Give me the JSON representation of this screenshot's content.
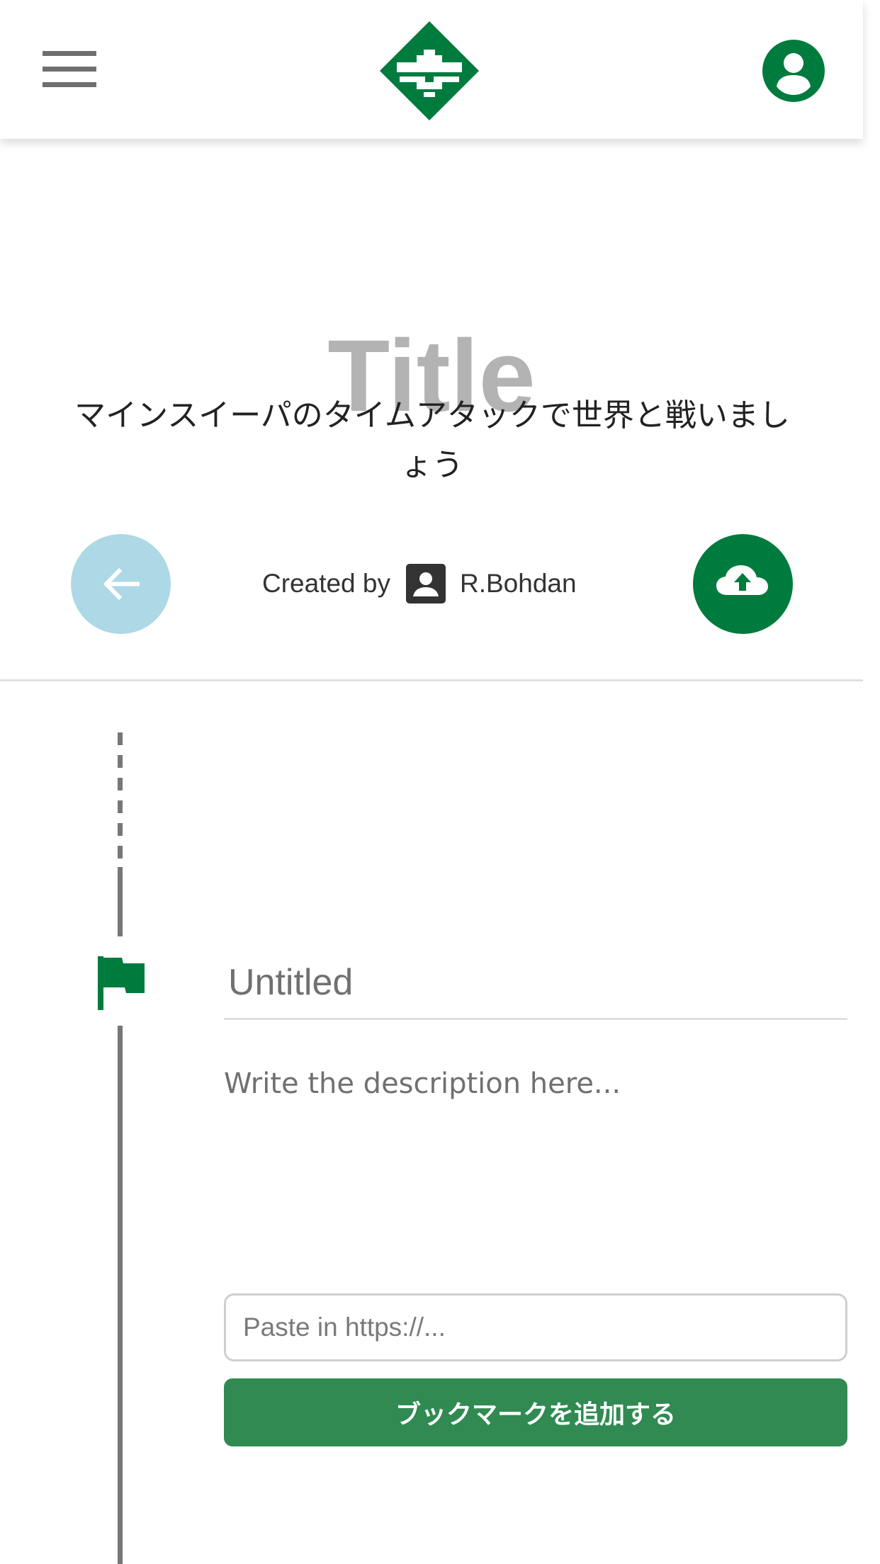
{
  "header": {
    "menu_icon": "hamburger-menu-icon",
    "logo_icon": "green-diamond-logo",
    "account_icon": "account-circle-icon",
    "accent_color": "#007b3e"
  },
  "page": {
    "title": "Title",
    "subtitle": "マインスイーパのタイムアタックで世界と戦いましょう"
  },
  "author": {
    "label": "Created by",
    "name": "R.Bohdan",
    "icon": "person-box-icon"
  },
  "actions": {
    "back_icon": "arrow-left-icon",
    "back_color": "#add8e6",
    "upload_icon": "cloud-upload-icon",
    "upload_color": "#007b3e"
  },
  "timeline": {
    "marker_icon": "flag-icon"
  },
  "entry": {
    "title_value": "",
    "title_placeholder": "Untitled",
    "description_value": "",
    "description_placeholder": "Write the description here...",
    "url_value": "",
    "url_placeholder": "Paste in https://...",
    "add_bookmark_label": "ブックマークを追加する",
    "button_color": "#308a52"
  }
}
